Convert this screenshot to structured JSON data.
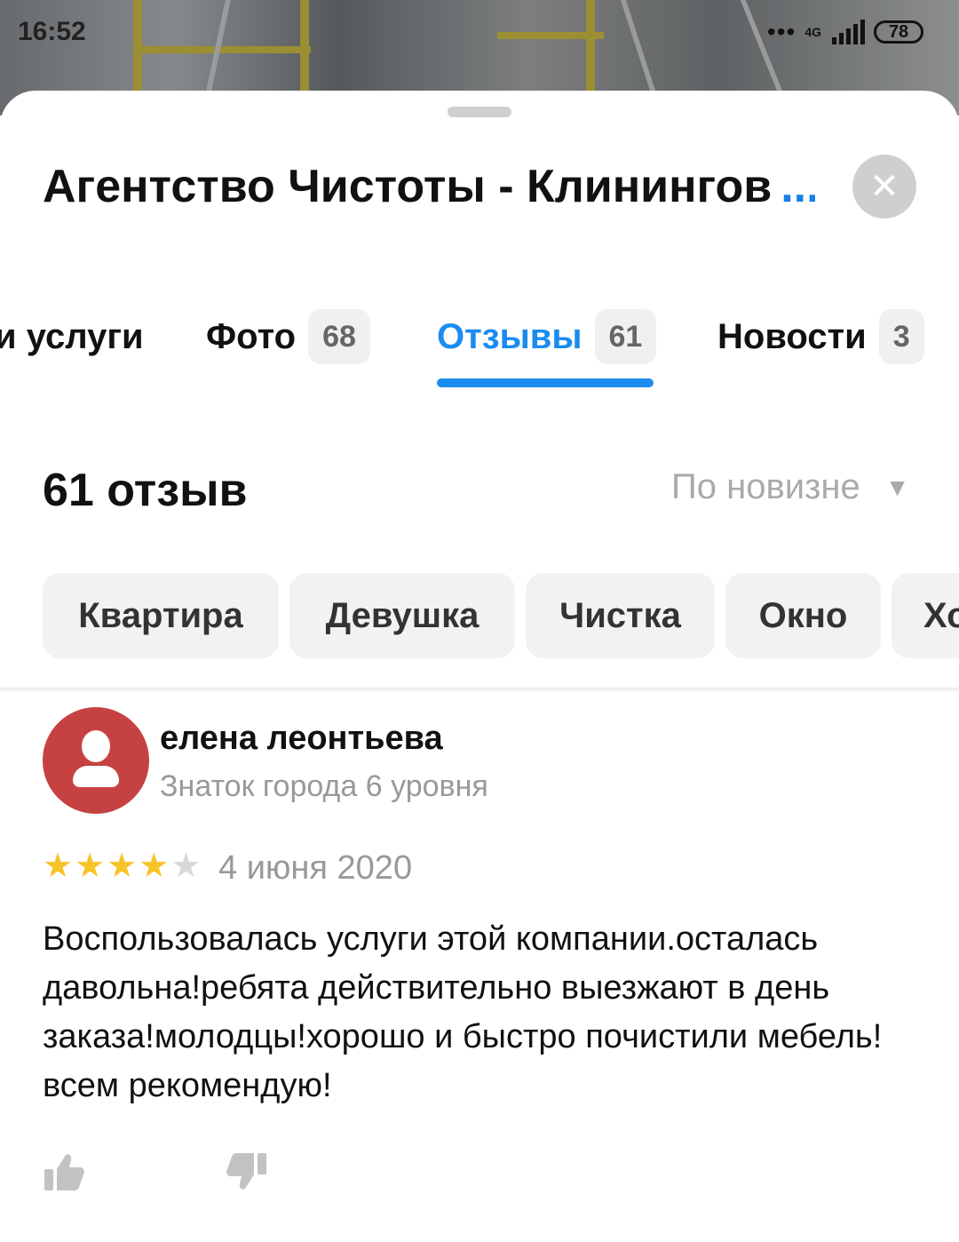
{
  "status_bar": {
    "time": "16:52",
    "network": "4G",
    "battery": "78",
    "dots": "•••"
  },
  "header": {
    "title": "Агентство Чистоты - Клинингов",
    "title_more": "...",
    "close_icon": "close-icon",
    "close_glyph": "✕"
  },
  "tabs": [
    {
      "label": "и услуги",
      "badge": ""
    },
    {
      "label": "Фото",
      "badge": "68"
    },
    {
      "label": "Отзывы",
      "badge": "61",
      "active": true
    },
    {
      "label": "Новости",
      "badge": "3"
    }
  ],
  "reviews": {
    "count_label": "61 отзыв",
    "sort_label": "По новизне",
    "sort_caret": "▼"
  },
  "chips": [
    "Квартира",
    "Девушка",
    "Чистка",
    "Окно",
    "Хо"
  ],
  "review": {
    "author": "елена леонтьева",
    "level": "Знаток города 6 уровня",
    "rating": 4,
    "rating_max": 5,
    "star_glyph": "★",
    "date": "4 июня 2020",
    "text": "Воспользовалась услуги этой компании.осталась давольна!ребята действительно выезжают в день заказа!молодцы!хорошо и быстро почистили мебель!всем рекомендую!"
  },
  "colors": {
    "accent": "#1a8cf0",
    "star": "#f7c327",
    "avatar": "#c64242"
  }
}
